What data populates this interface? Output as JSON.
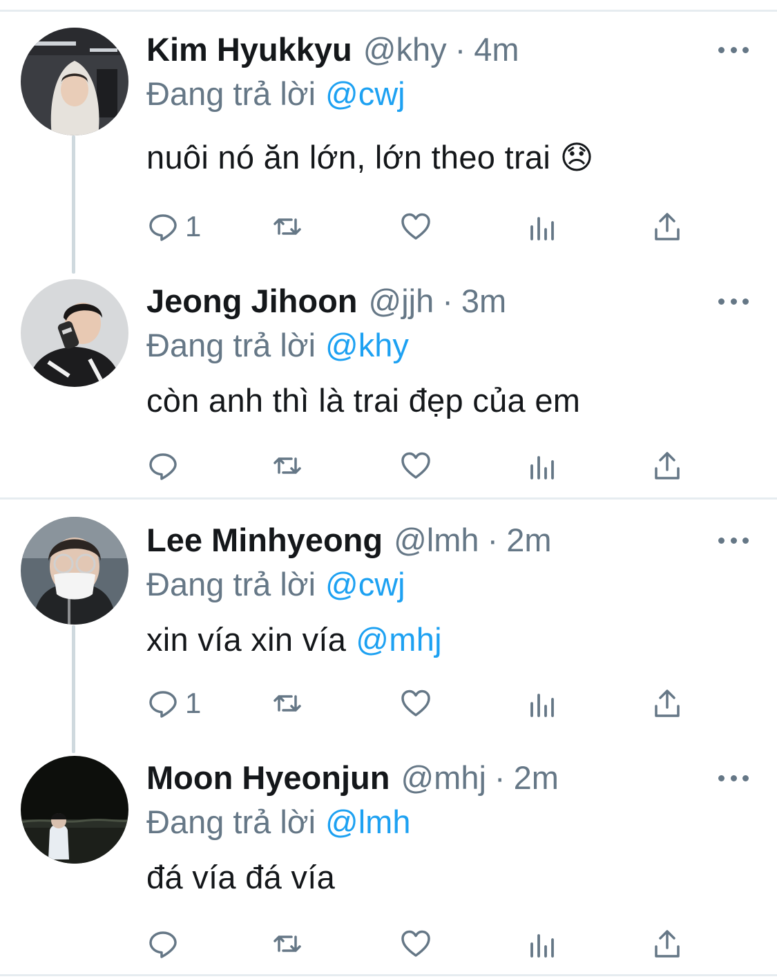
{
  "app": {
    "accent_color": "#1da1f2",
    "muted_color": "#657786"
  },
  "tweets": [
    {
      "name": "Kim Hyukkyu",
      "handle": "@khy",
      "time": "4m",
      "reply_prefix": "Đang trả lời",
      "reply_to": "@cwj",
      "text": "nuôi nó ăn lớn, lớn theo trai 😞",
      "mention": "",
      "reply_count": "1",
      "icons": [
        "reply-icon",
        "retweet-icon",
        "like-icon",
        "analytics-icon",
        "share-icon"
      ]
    },
    {
      "name": "Jeong Jihoon",
      "handle": "@jjh",
      "time": "3m",
      "reply_prefix": "Đang trả lời",
      "reply_to": "@khy",
      "text": "còn anh thì là trai đẹp của em",
      "mention": "",
      "reply_count": ""
    },
    {
      "name": "Lee Minhyeong",
      "handle": "@lmh",
      "time": "2m",
      "reply_prefix": "Đang trả lời",
      "reply_to": "@cwj",
      "text": "xin vía xin vía",
      "mention": "@mhj",
      "reply_count": "1"
    },
    {
      "name": "Moon Hyeonjun",
      "handle": "@mhj",
      "time": "2m",
      "reply_prefix": "Đang trả lời",
      "reply_to": "@lmh",
      "text": "đá vía đá vía",
      "mention": "",
      "reply_count": ""
    }
  ]
}
